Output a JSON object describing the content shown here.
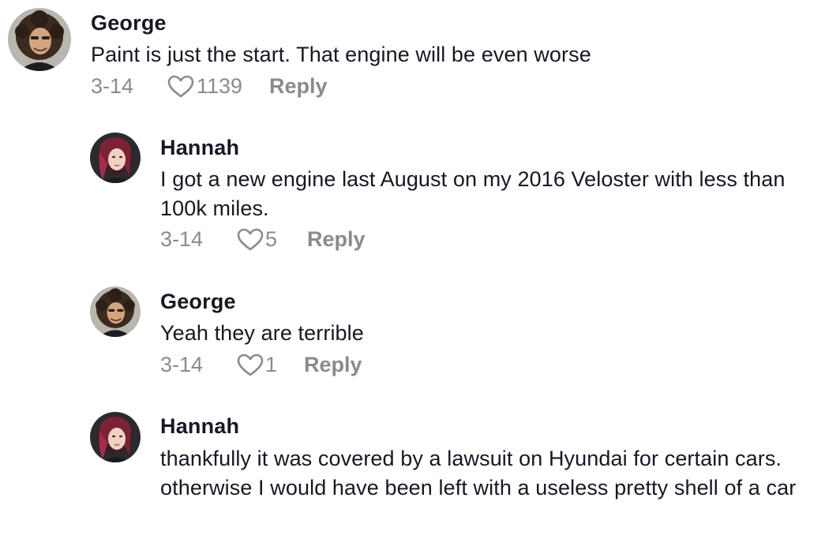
{
  "comments": [
    {
      "username": "George",
      "text": "Paint is just the start. That engine will be even worse",
      "date": "3-14",
      "likes": "1139",
      "reply_label": "Reply",
      "avatar": "avatar-george"
    },
    {
      "username": "Hannah",
      "text": "I got a new engine last August on my 2016 Veloster with less than 100k miles.",
      "date": "3-14",
      "likes": "5",
      "reply_label": "Reply",
      "avatar": "avatar-hannah"
    },
    {
      "username": "George",
      "text": "Yeah they are terrible",
      "date": "3-14",
      "likes": "1",
      "reply_label": "Reply",
      "avatar": "avatar-george"
    },
    {
      "username": "Hannah",
      "text": "thankfully it was covered by a lawsuit on Hyundai for certain cars. otherwise I would have been left with a useless pretty shell of a car",
      "avatar": "avatar-hannah"
    }
  ],
  "icons": {
    "like": "heart-outline-icon"
  },
  "colors": {
    "username": "#161823",
    "text": "#161823",
    "meta": "#8a8b91"
  }
}
